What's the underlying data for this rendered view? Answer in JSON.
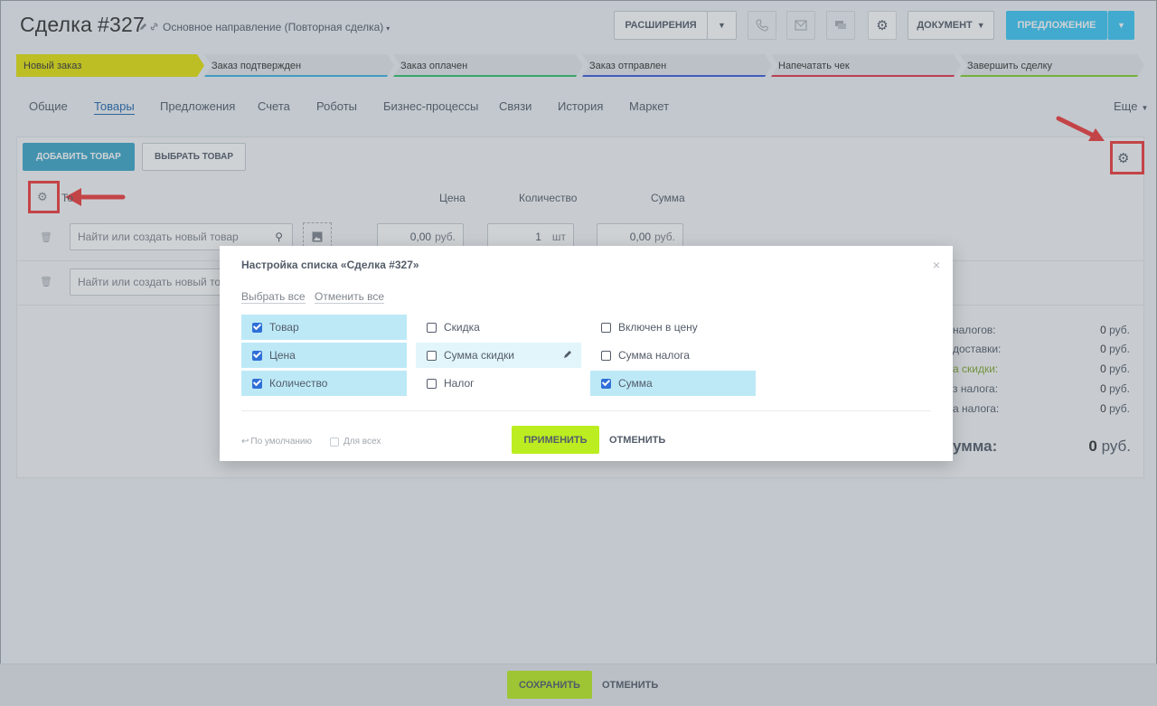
{
  "header": {
    "title_prefix": "Сделка",
    "title_number": "#327",
    "direction": "Основное направление (Повторная сделка)",
    "buttons": {
      "extensions": "РАСШИРЕНИЯ",
      "document": "ДОКУМЕНТ",
      "proposal": "ПРЕДЛОЖЕНИЕ"
    }
  },
  "stages": [
    {
      "label": "Новый заказ",
      "color": "#e5e30a"
    },
    {
      "label": "Заказ подтвержден",
      "color": "#39b5e6"
    },
    {
      "label": "Заказ оплачен",
      "color": "#2fc36e"
    },
    {
      "label": "Заказ отправлен",
      "color": "#3b5bd8"
    },
    {
      "label": "Напечатать чек",
      "color": "#e3344e"
    },
    {
      "label": "Завершить сделку",
      "color": "#84d231"
    }
  ],
  "tabs": [
    "Общие",
    "Товары",
    "Предложения",
    "Счета",
    "Роботы",
    "Бизнес-процессы",
    "Связи",
    "История",
    "Маркет"
  ],
  "tabs_more": "Еще",
  "products": {
    "add_button": "ДОБАВИТЬ ТОВАР",
    "choose_button": "ВЫБРАТЬ ТОВАР",
    "columns": {
      "product": "То",
      "price": "Цена",
      "quantity": "Количество",
      "sum": "Сумма"
    },
    "rows": [
      {
        "placeholder": "Найти или создать новый товар",
        "price": "0,00",
        "currency": "руб.",
        "quantity": "1",
        "unit": "шт",
        "sum": "0,00"
      },
      {
        "placeholder": "Найти или создать новый тов"
      }
    ],
    "summary": [
      {
        "label": "налогов:",
        "value": "0",
        "currency": "руб."
      },
      {
        "label": "доставки:",
        "value": "0",
        "currency": "руб."
      },
      {
        "label": "а скидки:",
        "value": "0",
        "currency": "руб."
      },
      {
        "label": "з налога:",
        "value": "0",
        "currency": "руб."
      },
      {
        "label": "а налога:",
        "value": "0",
        "currency": "руб."
      }
    ],
    "total_label": "умма:",
    "total_value": "0",
    "total_currency": "руб."
  },
  "dialog": {
    "title": "Настройка списка «Сделка #327»",
    "close": "×",
    "select_all": "Выбрать все",
    "cancel_all": "Отменить все",
    "options": [
      {
        "label": "Товар",
        "checked": true
      },
      {
        "label": "Цена",
        "checked": true
      },
      {
        "label": "Количество",
        "checked": true
      },
      {
        "label": "Скидка",
        "checked": false
      },
      {
        "label": "Сумма скидки",
        "checked": false
      },
      {
        "label": "Налог",
        "checked": false
      },
      {
        "label": "Включен в цену",
        "checked": false
      },
      {
        "label": "Сумма налога",
        "checked": false
      },
      {
        "label": "Сумма",
        "checked": true
      }
    ],
    "default_link": "По умолчанию",
    "for_all": "Для всех",
    "apply": "ПРИМЕНИТЬ",
    "cancel": "ОТМЕНИТЬ"
  },
  "footer": {
    "save": "СОХРАНИТЬ",
    "cancel": "ОТМЕНИТЬ"
  },
  "colors": {
    "accent_blue": "#3bc8f5",
    "accent_green": "#bbed21",
    "highlight_red": "#ef3b3b"
  }
}
